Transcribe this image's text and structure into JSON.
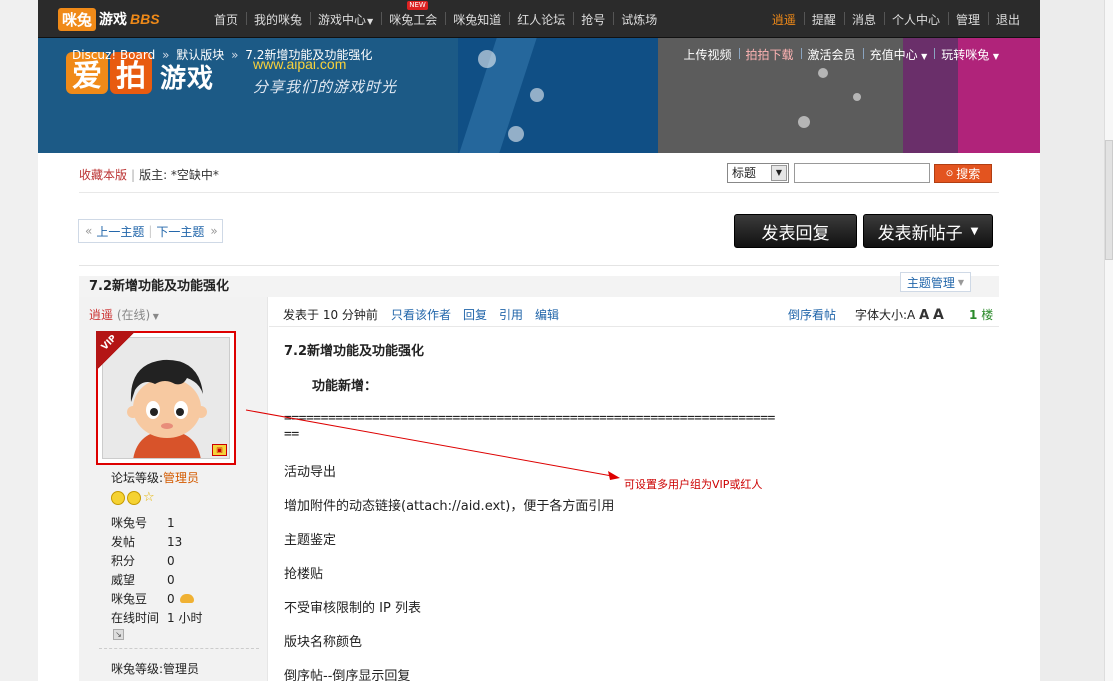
{
  "topnav": {
    "logo_box": "咪兔",
    "logo_text": "游戏",
    "logo_bbs": "BBS",
    "left_items": [
      {
        "label": "首页"
      },
      {
        "label": "我的咪兔"
      },
      {
        "label": "游戏中心",
        "dropdown": true
      },
      {
        "label": "咪兔工会",
        "badge": "NEW"
      },
      {
        "label": "咪兔知道"
      },
      {
        "label": "红人论坛"
      },
      {
        "label": "抢号"
      },
      {
        "label": "试炼场"
      }
    ],
    "right_items": [
      {
        "label": "逍遥",
        "active": true
      },
      {
        "label": "提醒"
      },
      {
        "label": "消息"
      },
      {
        "label": "个人中心"
      },
      {
        "label": "管理"
      },
      {
        "label": "退出"
      }
    ]
  },
  "banner": {
    "brand_chars": [
      "爱",
      "拍"
    ],
    "brand_game": "游戏",
    "url": "www.aipai.com",
    "slogan": "分享我们的游戏时光",
    "breadcrumb": {
      "root": "Discuz! Board",
      "section": "默认版块",
      "current": "7.2新增功能及功能强化",
      "separator": "»"
    },
    "quick_links": [
      {
        "label": "上传视频"
      },
      {
        "label": "拍拍下载",
        "hot": true
      },
      {
        "label": "激活会员"
      },
      {
        "label": "充值中心",
        "dropdown": true
      },
      {
        "label": "玩转咪兔",
        "dropdown": true
      }
    ]
  },
  "forum_tools": {
    "favorite": "收藏本版",
    "moderator": "版主: *空缺中*",
    "search_select": "标题",
    "search_value": "",
    "search_button": "搜索"
  },
  "thread_nav": {
    "prev": "上一主题",
    "next": "下一主题",
    "reply_button": "发表回复",
    "new_post_button": "发表新帖子"
  },
  "thread": {
    "title": "7.2新增功能及功能强化",
    "manage_button": "主题管理"
  },
  "author": {
    "name": "逍遥",
    "status": "(在线)",
    "vip_label": "VIP",
    "level_label": "论坛等级:",
    "level_value": "管理员",
    "stats": [
      {
        "key": "咪兔号",
        "value": "1"
      },
      {
        "key": "发帖",
        "value": "13"
      },
      {
        "key": "积分",
        "value": "0"
      },
      {
        "key": "威望",
        "value": "0"
      },
      {
        "key": "咪兔豆",
        "value": "0"
      },
      {
        "key": "在线时间",
        "value": "1 小时"
      }
    ],
    "mitu_level": "咪兔等级:管理员"
  },
  "post": {
    "posted": "发表于 10 分钟前",
    "actions": [
      "只看该作者",
      "回复",
      "引用",
      "编辑"
    ],
    "reverse": "倒序看帖",
    "font_size_label": "字体大小:",
    "font_sizes": [
      "A",
      "A",
      "A"
    ],
    "floor_number": "1",
    "floor_label": "楼",
    "heading": "7.2新增功能及功能强化",
    "subheading": "功能新增：",
    "separator_line": "===================================================================",
    "lines": [
      "活动导出",
      "增加附件的动态链接(attach://aid.ext)，便于各方面引用",
      "主题鉴定",
      "抢楼贴",
      "不受审核限制的 IP 列表",
      "版块名称颜色",
      "倒序帖--倒序显示回复"
    ]
  },
  "annotation": {
    "text": "可设置多用户组为VIP或红人"
  }
}
